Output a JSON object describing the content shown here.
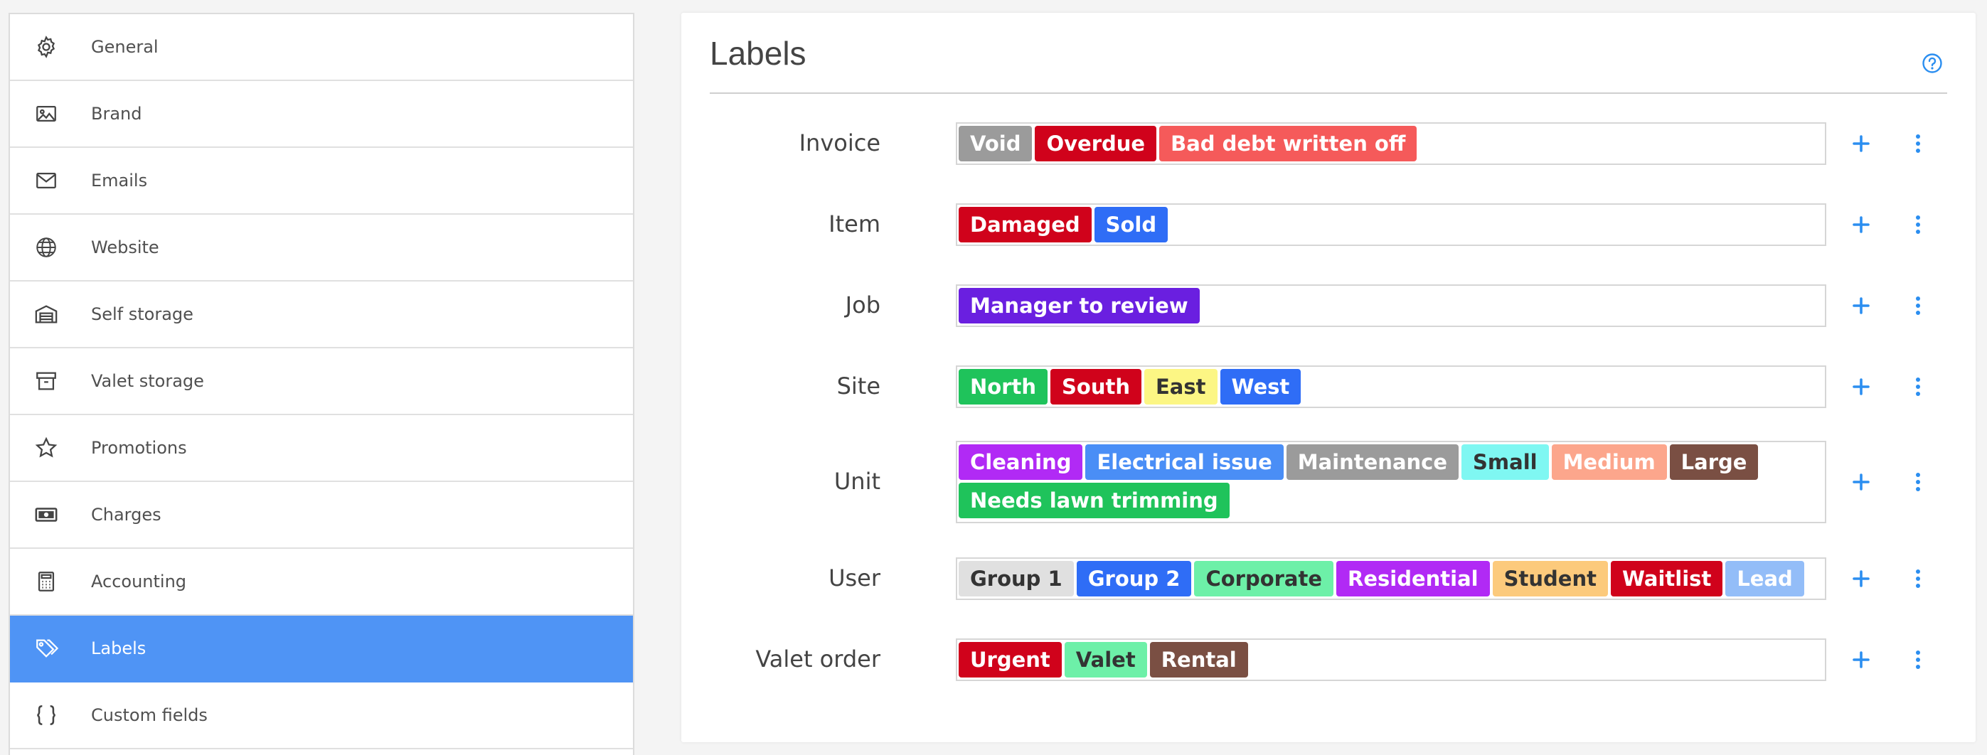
{
  "sidebar": {
    "items": [
      {
        "label": "General",
        "icon": "gear-icon"
      },
      {
        "label": "Brand",
        "icon": "image-icon"
      },
      {
        "label": "Emails",
        "icon": "envelope-icon"
      },
      {
        "label": "Website",
        "icon": "globe-icon"
      },
      {
        "label": "Self storage",
        "icon": "warehouse-icon"
      },
      {
        "label": "Valet storage",
        "icon": "archive-box-icon"
      },
      {
        "label": "Promotions",
        "icon": "star-icon"
      },
      {
        "label": "Charges",
        "icon": "cash-icon"
      },
      {
        "label": "Accounting",
        "icon": "calculator-icon"
      },
      {
        "label": "Labels",
        "icon": "tags-icon",
        "active": true
      },
      {
        "label": "Custom fields",
        "icon": "braces-icon"
      }
    ]
  },
  "main": {
    "title": "Labels",
    "rows": [
      {
        "name": "Invoice",
        "tags": [
          {
            "text": "Void",
            "bg": "#9b9b9b",
            "fg": "#ffffff"
          },
          {
            "text": "Overdue",
            "bg": "#d0021b",
            "fg": "#ffffff"
          },
          {
            "text": "Bad debt written off",
            "bg": "#f55a5a",
            "fg": "#ffffff"
          }
        ]
      },
      {
        "name": "Item",
        "tags": [
          {
            "text": "Damaged",
            "bg": "#d0021b",
            "fg": "#ffffff"
          },
          {
            "text": "Sold",
            "bg": "#2f6df6",
            "fg": "#ffffff"
          }
        ]
      },
      {
        "name": "Job",
        "tags": [
          {
            "text": "Manager to review",
            "bg": "#6a1fe0",
            "fg": "#ffffff"
          }
        ]
      },
      {
        "name": "Site",
        "tags": [
          {
            "text": "North",
            "bg": "#1fc35b",
            "fg": "#ffffff"
          },
          {
            "text": "South",
            "bg": "#d0021b",
            "fg": "#ffffff"
          },
          {
            "text": "East",
            "bg": "#fcf684",
            "fg": "#333333"
          },
          {
            "text": "West",
            "bg": "#2f6df6",
            "fg": "#ffffff"
          }
        ]
      },
      {
        "name": "Unit",
        "tags": [
          {
            "text": "Cleaning",
            "bg": "#b12af5",
            "fg": "#ffffff"
          },
          {
            "text": "Electrical issue",
            "bg": "#4a8ef6",
            "fg": "#ffffff"
          },
          {
            "text": "Maintenance",
            "bg": "#9b9b9b",
            "fg": "#ffffff"
          },
          {
            "text": "Small",
            "bg": "#7ff7f2",
            "fg": "#333333"
          },
          {
            "text": "Medium",
            "bg": "#fca68c",
            "fg": "#ffffff"
          },
          {
            "text": "Large",
            "bg": "#7a4f43",
            "fg": "#ffffff"
          },
          {
            "text": "Needs lawn trimming",
            "bg": "#1fc35b",
            "fg": "#ffffff"
          }
        ]
      },
      {
        "name": "User",
        "tags": [
          {
            "text": "Group 1",
            "bg": "#e0e0e0",
            "fg": "#333333"
          },
          {
            "text": "Group 2",
            "bg": "#2f6df6",
            "fg": "#ffffff"
          },
          {
            "text": "Corporate",
            "bg": "#6df0a8",
            "fg": "#333333"
          },
          {
            "text": "Residential",
            "bg": "#b12af5",
            "fg": "#ffffff"
          },
          {
            "text": "Student",
            "bg": "#fcca7c",
            "fg": "#333333"
          },
          {
            "text": "Waitlist",
            "bg": "#d0021b",
            "fg": "#ffffff"
          },
          {
            "text": "Lead",
            "bg": "#93bdf8",
            "fg": "#ffffff"
          }
        ]
      },
      {
        "name": "Valet order",
        "tags": [
          {
            "text": "Urgent",
            "bg": "#d0021b",
            "fg": "#ffffff"
          },
          {
            "text": "Valet",
            "bg": "#6df0a8",
            "fg": "#333333"
          },
          {
            "text": "Rental",
            "bg": "#7a4f43",
            "fg": "#ffffff"
          }
        ]
      }
    ]
  },
  "colors": {
    "accent": "#4f94f5",
    "action_icon": "#2b8ef0"
  }
}
